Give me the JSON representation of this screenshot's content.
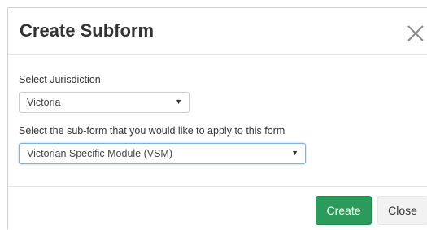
{
  "dialog": {
    "title": "Create Subform",
    "close_icon": "close-x-icon"
  },
  "form": {
    "jurisdiction": {
      "label": "Select Jurisdiction",
      "selected": "Victoria"
    },
    "subform": {
      "label": "Select the sub-form that you would like to apply to this form",
      "selected": "Victorian Specific Module (VSM)"
    }
  },
  "footer": {
    "create_label": "Create",
    "close_label": "Close"
  },
  "colors": {
    "create_button": "#2c9a5a",
    "close_button": "#f2f2f2",
    "focus_border": "#7fb0e6"
  }
}
